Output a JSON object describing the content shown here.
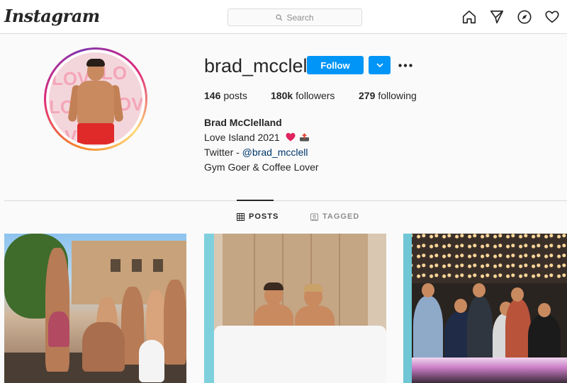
{
  "nav": {
    "logo": "Instagram",
    "search_placeholder": "Search",
    "icons": [
      "home-icon",
      "direct-icon",
      "explore-icon",
      "activity-heart-icon"
    ]
  },
  "profile": {
    "username": "brad_mcclell",
    "follow_label": "Follow",
    "stats": {
      "posts_count": "146",
      "posts_label": "posts",
      "followers_count": "180k",
      "followers_label": "followers",
      "following_count": "279",
      "following_label": "following"
    },
    "bio": {
      "full_name": "Brad McClelland",
      "line1": "Love Island 2021",
      "line2_prefix": "Twitter - ",
      "line2_handle": "@brad_mcclell",
      "line3": "Gym Goer & Coffee Lover"
    }
  },
  "tabs": [
    {
      "label": "POSTS",
      "active": true
    },
    {
      "label": "TAGGED",
      "active": false
    }
  ],
  "colors": {
    "accent": "#0095f6",
    "border": "#dbdbdb",
    "link": "#00376b",
    "text": "#262626",
    "muted": "#8e8e8e"
  }
}
